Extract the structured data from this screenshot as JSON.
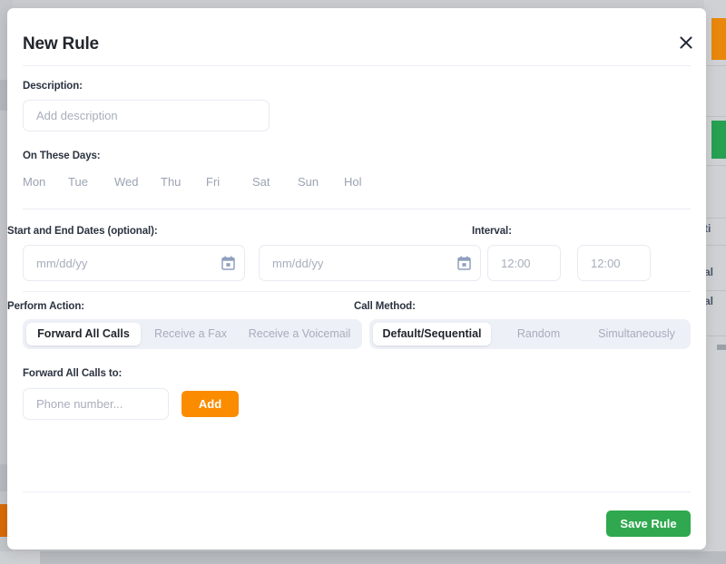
{
  "modal": {
    "title": "New Rule",
    "close_icon": "close-icon"
  },
  "description": {
    "label": "Description:",
    "placeholder": "Add description",
    "value": ""
  },
  "days": {
    "label": "On These Days:",
    "items": [
      {
        "label": "Mon",
        "selected": false
      },
      {
        "label": "Tue",
        "selected": false
      },
      {
        "label": "Wed",
        "selected": false
      },
      {
        "label": "Thu",
        "selected": false
      },
      {
        "label": "Fri",
        "selected": false
      },
      {
        "label": "Sat",
        "selected": false
      },
      {
        "label": "Sun",
        "selected": false
      },
      {
        "label": "Hol",
        "selected": false
      }
    ]
  },
  "dates": {
    "label": "Start and End Dates (optional):",
    "start": {
      "placeholder": "mm/dd/yy",
      "value": "",
      "icon": "calendar-icon"
    },
    "end": {
      "placeholder": "mm/dd/yy",
      "value": "",
      "icon": "calendar-icon"
    }
  },
  "interval": {
    "label": "Interval:",
    "from": {
      "placeholder": "12:00",
      "value": ""
    },
    "to": {
      "placeholder": "12:00",
      "value": ""
    }
  },
  "perform_action": {
    "label": "Perform Action:",
    "options": [
      {
        "label": "Forward All Calls",
        "selected": true
      },
      {
        "label": "Receive a Fax",
        "selected": false
      },
      {
        "label": "Receive a Voicemail",
        "selected": false
      }
    ]
  },
  "call_method": {
    "label": "Call Method:",
    "options": [
      {
        "label": "Default/Sequential",
        "selected": true
      },
      {
        "label": "Random",
        "selected": false
      },
      {
        "label": "Simultaneously",
        "selected": false
      }
    ]
  },
  "forward_to": {
    "label": "Forward All Calls to:",
    "placeholder": "Phone number...",
    "value": "",
    "add_label": "Add"
  },
  "footer": {
    "save_label": "Save Rule"
  },
  "background": {
    "text_fragments": [
      "ti",
      "al",
      "al"
    ]
  },
  "colors": {
    "accent_orange": "#fb8c00",
    "accent_green": "#2fa84f",
    "segment_bg": "#eef0f7",
    "text_dark": "#22262c",
    "text_muted": "#a6adbb",
    "backdrop": "#c9cbcf"
  }
}
